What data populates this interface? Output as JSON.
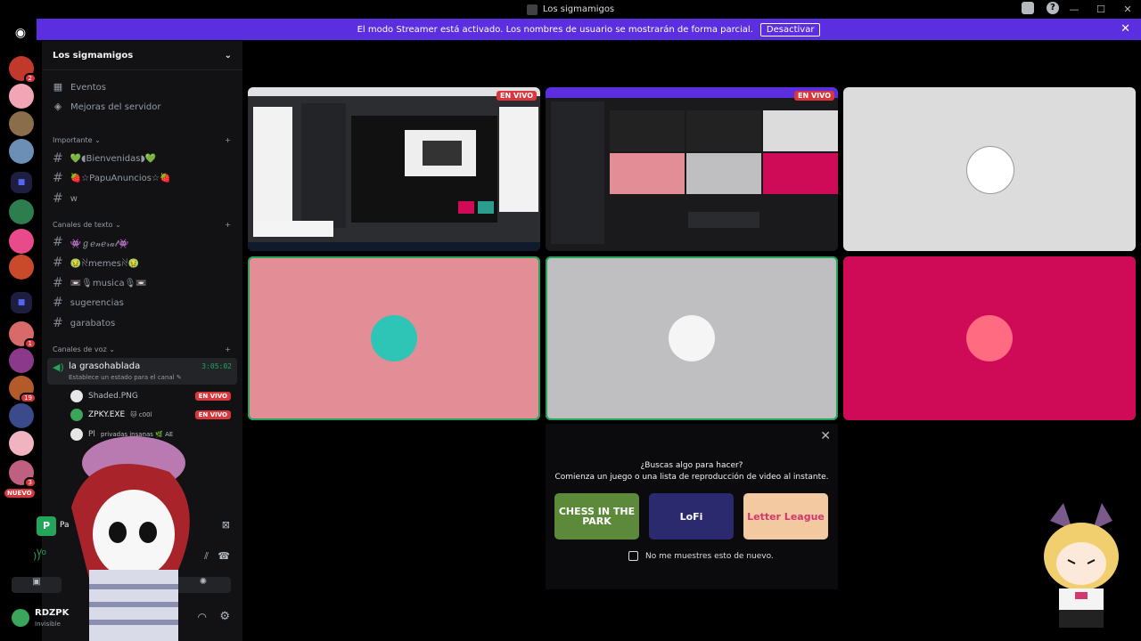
{
  "window": {
    "title": "Los sigmamigos"
  },
  "banner": {
    "message": "El modo Streamer está activado. Los nombres de usuario se mostrarán de forma parcial.",
    "button": "Desactivar"
  },
  "guilds": {
    "new_badge": "NUEVO",
    "badges": [
      "2",
      "1",
      "19",
      "3"
    ]
  },
  "server": {
    "name": "Los sigmamigos",
    "top_items": [
      "Eventos",
      "Mejoras del servidor"
    ],
    "categories": [
      {
        "name": "Importante",
        "channels": [
          "💚◖Bienvenidas◗💚",
          "🍓☆PapuAnuncios☆🍓",
          "w"
        ]
      },
      {
        "name": "Canales de texto",
        "channels": [
          "👾ℊℯ𝓃ℯ𝓇𝒶𝓁👾",
          "🤢ꋊmemesꋊ🤢",
          "📼🎙musica🎙📼",
          "sugerencias",
          "garabatos"
        ]
      },
      {
        "name": "Canales de voz",
        "channels": []
      }
    ]
  },
  "voice": {
    "channel_name": "la grasohablada",
    "elapsed": "3:05:02",
    "status_hint": "Establece un estado para el canal",
    "users": [
      {
        "name": "Shaded.PNG",
        "status": "",
        "live": "EN VIVO"
      },
      {
        "name": "ZPKY.EXE",
        "status": "🐱 c00l",
        "live": "EN VIVO"
      },
      {
        "name": "Pl",
        "status": "privadas insanas 🌿 AE",
        "live": ""
      }
    ]
  },
  "panel": {
    "activity_label": "Pa",
    "voice_label": "Vo",
    "user_name": "RDZPK",
    "user_status": "Invisible"
  },
  "stage": {
    "live_label": "EN VIVO",
    "tiles": [
      {
        "kind": "screen",
        "live": true,
        "color": "#1e1f22"
      },
      {
        "kind": "screen",
        "live": true,
        "color": "#1a1a1c"
      },
      {
        "kind": "avatar",
        "live": false,
        "color": "#dcdcdc"
      },
      {
        "kind": "avatar",
        "live": false,
        "color": "#e38e96"
      },
      {
        "kind": "avatar",
        "live": false,
        "color": "#bfbfc1"
      },
      {
        "kind": "avatar",
        "live": false,
        "color": "#cf0a57"
      }
    ]
  },
  "activity": {
    "title": "¿Buscas algo para hacer?",
    "subtitle": "Comienza un juego o una lista de reproducción de video al instante.",
    "cards": [
      {
        "label": "CHESS IN THE PARK",
        "color": "#5c8a3a"
      },
      {
        "label": "LoFi",
        "color": "#2c2a6e"
      },
      {
        "label": "Letter League",
        "color": "#f2c9a0"
      }
    ],
    "dont_show": "No me muestres esto de nuevo."
  },
  "colors": {
    "accent": "#5b2ee0",
    "live": "#da373c",
    "online": "#23a55a"
  }
}
